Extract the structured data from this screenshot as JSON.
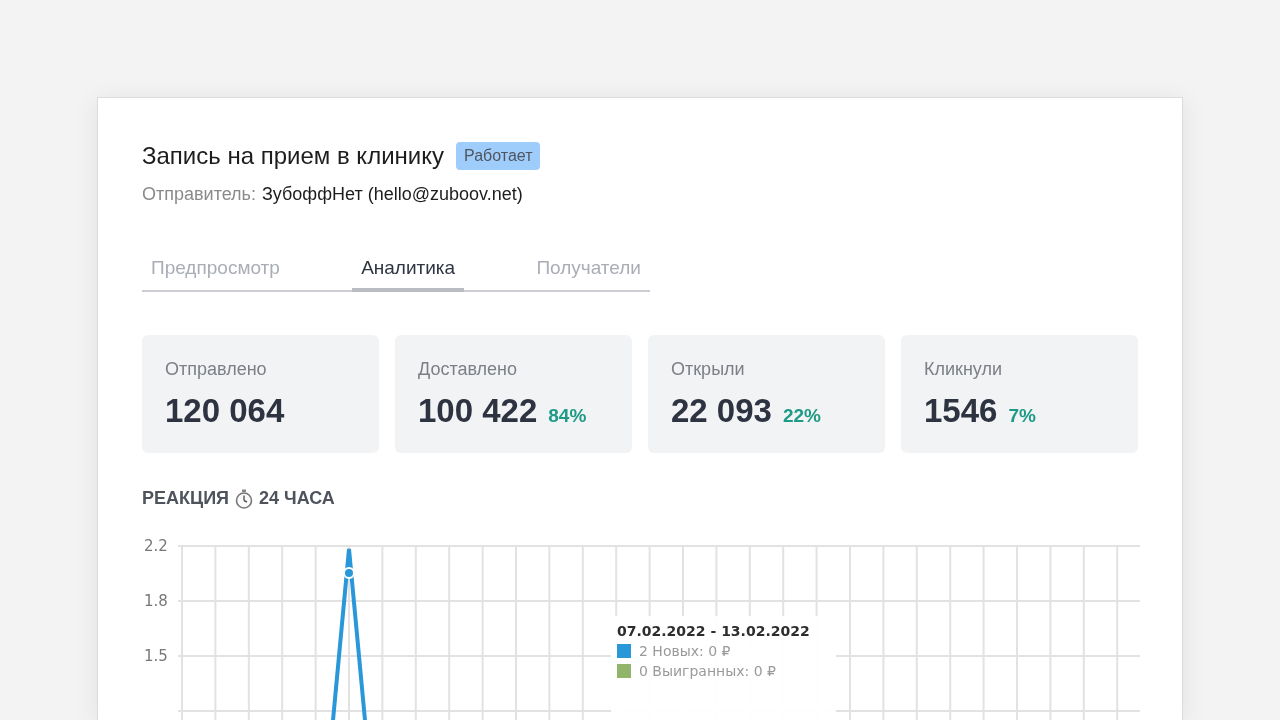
{
  "campaign": {
    "title": "Запись на прием в клинику",
    "status": "Работает",
    "sender_label": "Отправитель:",
    "sender": "ЗубоффНет (hello@zuboov.net)"
  },
  "tabs": [
    {
      "label": "Предпросмотр",
      "selected": false
    },
    {
      "label": "Аналитика",
      "selected": true
    },
    {
      "label": "Получатели",
      "selected": false
    }
  ],
  "stats": [
    {
      "label": "Отправлено",
      "value": "120 064"
    },
    {
      "label": "Доставлено",
      "value": "100 422",
      "percent": "84%"
    },
    {
      "label": "Открыли",
      "value": "22 093",
      "percent": "22%"
    },
    {
      "label": "Кликнули",
      "value": "1546",
      "percent": "7%"
    }
  ],
  "reaction": {
    "title_before": "РЕАКЦИЯ",
    "title_after": "24 ЧАСА",
    "y_axis_labels": [
      "2.2",
      "1.8",
      "1.5"
    ],
    "tooltip": {
      "title": "07.02.2022 - 13.02.2022",
      "items": [
        {
          "text": "2 Новых: 0 ₽",
          "color": "#2a97d8"
        },
        {
          "text": "0 Выигранных: 0 ₽",
          "color": "#8fb46a"
        }
      ]
    }
  }
}
